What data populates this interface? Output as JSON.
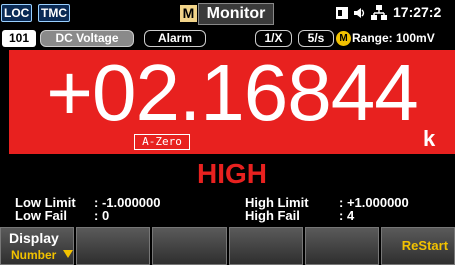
{
  "status": {
    "loc": "LOC",
    "tmc": "TMC",
    "mode_letter": "M",
    "mode_title": "Monitor",
    "time": "17:27:2"
  },
  "subheader": {
    "channel": "101",
    "function": "DC Voltage",
    "alarm": "Alarm",
    "ratio": "1/X",
    "rate": "5/s",
    "range_badge": "M",
    "range": "Range: 100mV"
  },
  "reading": {
    "value": "+02.16844",
    "autozero": "A-Zero",
    "unit_prefix": "k"
  },
  "alarm_panel": {
    "state": "HIGH",
    "low_limit_label": "Low Limit",
    "low_limit_value": ": -1.000000",
    "low_fail_label": "Low Fail",
    "low_fail_value": ": 0",
    "high_limit_label": "High Limit",
    "high_limit_value": ": +1.000000",
    "high_fail_label": "High Fail",
    "high_fail_value": ": 4"
  },
  "softkeys": {
    "display_label": "Display",
    "display_value": "Number",
    "restart_label": "ReStart"
  },
  "colors": {
    "reading_bg": "#e8211f",
    "accent": "#f2c200",
    "alarm_text": "#e8211f"
  }
}
